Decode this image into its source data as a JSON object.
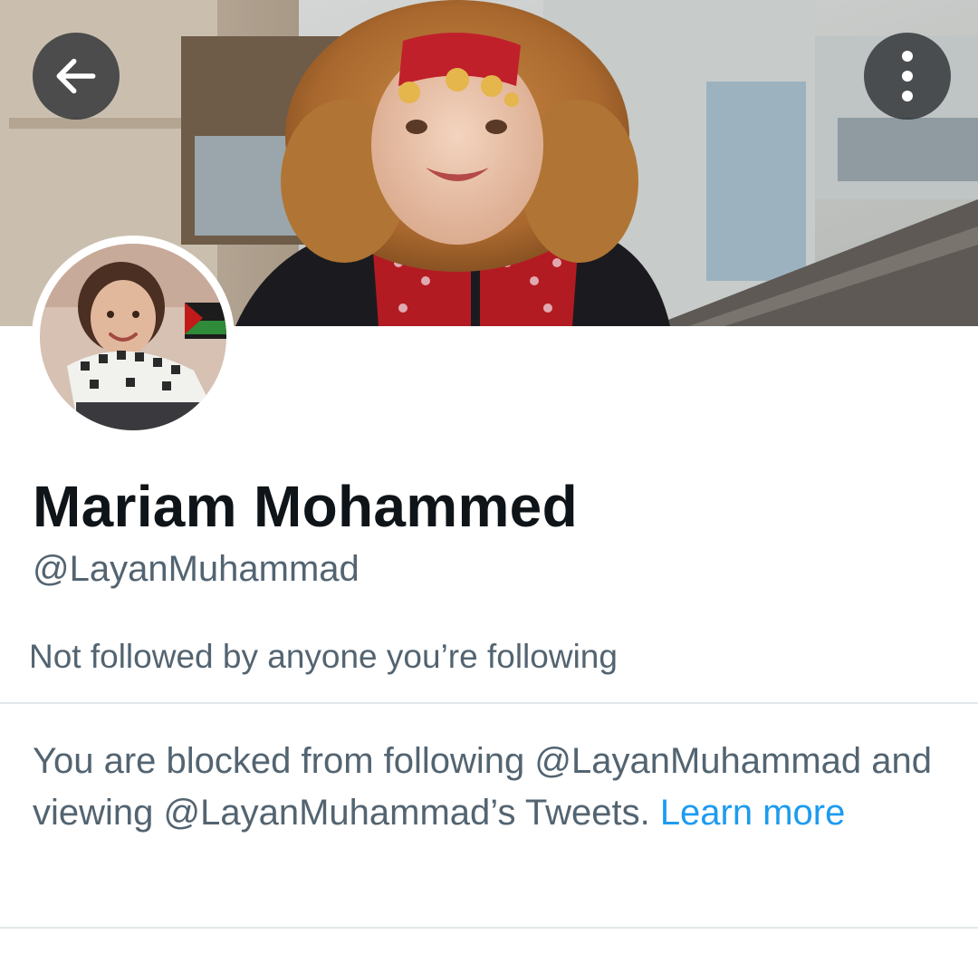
{
  "header": {
    "back_icon": "arrow-left-icon",
    "more_icon": "more-vertical-icon"
  },
  "profile": {
    "display_name": "Mariam Mohammed",
    "handle": "@LayanMuhammad",
    "followed_by_note": "Not followed by anyone you’re following"
  },
  "blocked_notice": {
    "text": "You are blocked from following @LayanMuhammad and viewing @LayanMuhammad’s Tweets.",
    "link_label": "Learn more"
  },
  "colors": {
    "primary_text": "#0f1419",
    "secondary_text": "#536471",
    "link": "#1d9bf0",
    "divider": "#e2e8ec"
  }
}
